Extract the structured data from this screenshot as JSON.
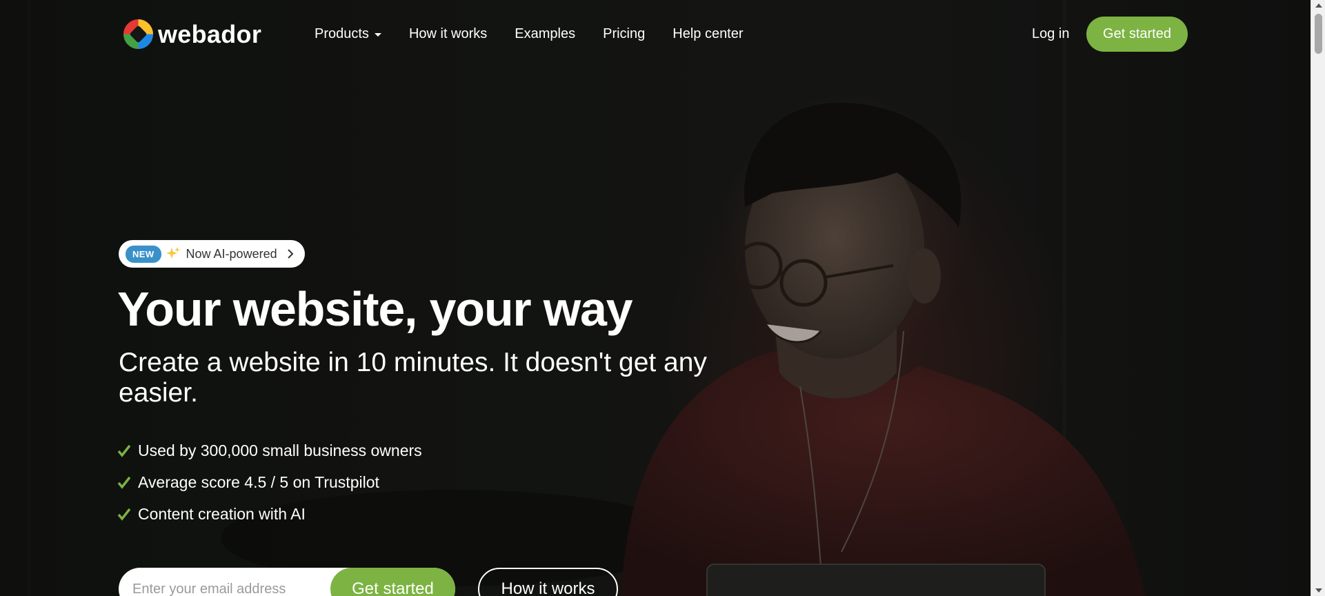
{
  "brand": {
    "name": "webador",
    "logo_icon": "webador-logo-icon"
  },
  "nav": {
    "items": [
      {
        "label": "Products",
        "has_dropdown": true
      },
      {
        "label": "How it works"
      },
      {
        "label": "Examples"
      },
      {
        "label": "Pricing"
      },
      {
        "label": "Help center"
      }
    ],
    "login_label": "Log in",
    "cta_label": "Get started"
  },
  "hero": {
    "badge": {
      "tag": "NEW",
      "text": "Now AI-powered",
      "icon": "sparkle-icon"
    },
    "title": "Your website, your way",
    "subtitle": "Create a website in 10 minutes. It doesn't get any easier.",
    "features": [
      "Used by 300,000 small business owners",
      "Average score 4.5 / 5 on Trustpilot",
      "Content creation with AI"
    ],
    "email_placeholder": "Enter your email address",
    "email_cta": "Get started",
    "secondary_cta": "How it works"
  },
  "colors": {
    "accent": "#7cb342",
    "badge_new": "#3a91c9",
    "background": "#151714"
  }
}
